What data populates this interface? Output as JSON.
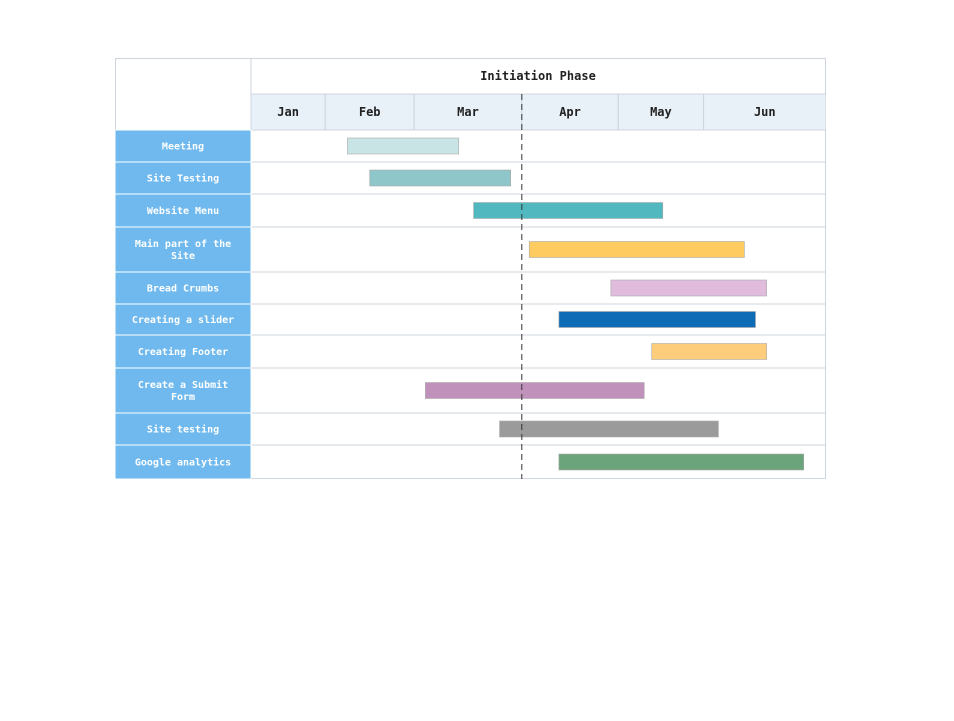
{
  "chart_data": {
    "type": "gantt",
    "title": "Initiation Phase",
    "months": [
      "Jan",
      "Feb",
      "Mar",
      "Apr",
      "May",
      "Jun"
    ],
    "month_ranges": [
      [
        0.0,
        1.0
      ],
      [
        1.0,
        2.2
      ],
      [
        2.2,
        3.65
      ],
      [
        3.65,
        4.95
      ],
      [
        4.95,
        6.1
      ],
      [
        6.1,
        7.75
      ]
    ],
    "today_marker": 3.65,
    "tasks": [
      {
        "name": "Meeting",
        "start": 1.3,
        "end": 2.8,
        "color": "#c9e4e4"
      },
      {
        "name": "Site Testing",
        "start": 1.6,
        "end": 3.5,
        "color": "#8ec6c9"
      },
      {
        "name": "Website Menu",
        "start": 3.0,
        "end": 5.55,
        "color": "#51b8bf"
      },
      {
        "name": "Main part of the Site",
        "start": 3.75,
        "end": 6.65,
        "color": "#fdcb5f"
      },
      {
        "name": "Bread Crumbs",
        "start": 4.85,
        "end": 6.95,
        "color": "#e1bbdb"
      },
      {
        "name": "Creating a slider",
        "start": 4.15,
        "end": 6.8,
        "color": "#0e6bb6"
      },
      {
        "name": "Creating Footer",
        "start": 5.4,
        "end": 6.95,
        "color": "#fdcd7b"
      },
      {
        "name": "Create a Submit Form",
        "start": 2.35,
        "end": 5.3,
        "color": "#c092bb"
      },
      {
        "name": "Site testing",
        "start": 3.35,
        "end": 6.3,
        "color": "#9b9b9b"
      },
      {
        "name": "Google analytics",
        "start": 4.15,
        "end": 7.45,
        "color": "#6ba37a"
      }
    ],
    "colors": {
      "label_column": "#6fb9ee",
      "month_header": "#e8f0f8",
      "grid": "#cfd5dc",
      "text": "#222222",
      "label_text": "#ffffff"
    }
  }
}
